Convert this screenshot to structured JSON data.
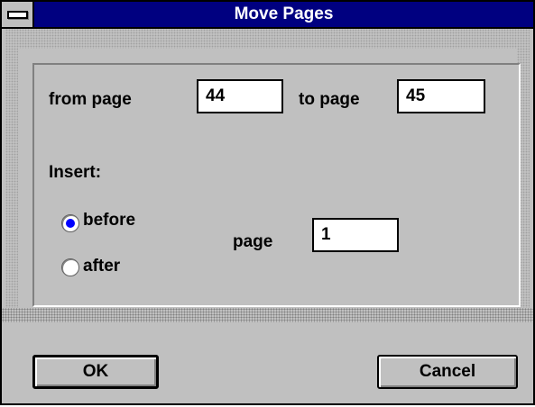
{
  "window": {
    "title": "Move Pages"
  },
  "range": {
    "from_label": "from page",
    "from_value": "44",
    "to_label": "to page",
    "to_value": "45"
  },
  "insert": {
    "label": "Insert:",
    "options": [
      {
        "label": "before",
        "selected": true
      },
      {
        "label": "after",
        "selected": false
      }
    ],
    "page_label": "page",
    "page_value": "1"
  },
  "buttons": {
    "ok": "OK",
    "cancel": "Cancel"
  },
  "colors": {
    "titlebar": "#000080",
    "face": "#c0c0c0",
    "radio_selected": "#0000ff"
  }
}
